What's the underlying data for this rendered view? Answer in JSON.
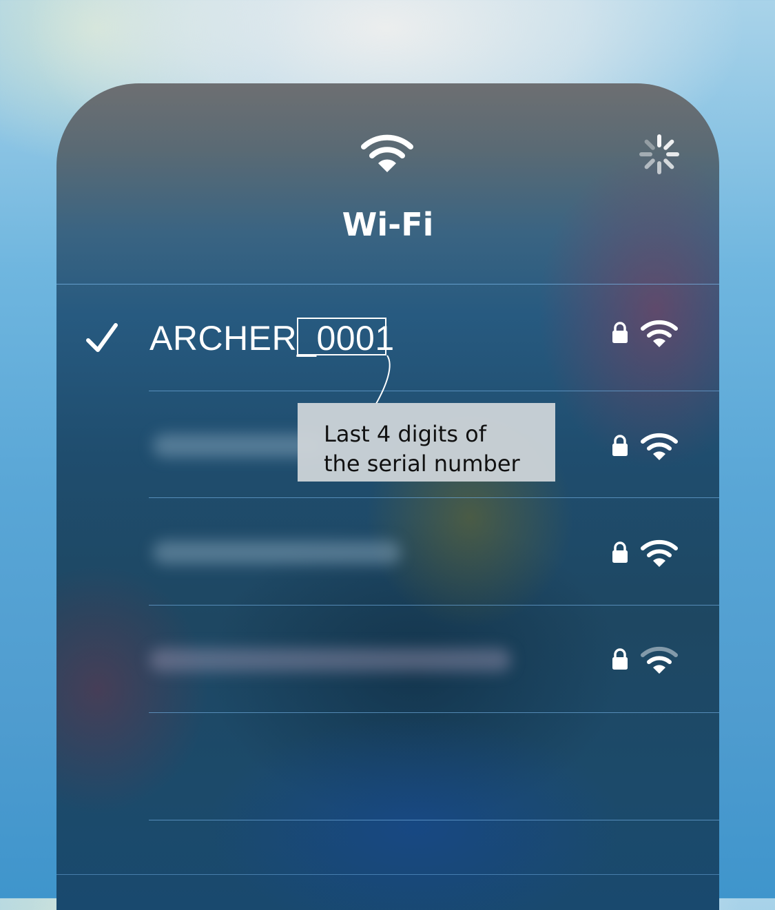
{
  "header": {
    "title": "Wi-Fi",
    "icon": "wifi-icon",
    "spinner_icon": "loading-spinner-icon"
  },
  "networks": [
    {
      "name": "ARCHER_0001",
      "connected": true,
      "secured": true,
      "signal": "full",
      "name_visible": true
    },
    {
      "name": "",
      "connected": false,
      "secured": true,
      "signal": "full",
      "name_visible": false
    },
    {
      "name": "",
      "connected": false,
      "secured": true,
      "signal": "full",
      "name_visible": false
    },
    {
      "name": "",
      "connected": false,
      "secured": true,
      "signal": "medium",
      "name_visible": false
    }
  ],
  "annotation": {
    "highlighted_text": "0001",
    "line1": "Last 4 digits of",
    "line2": "the serial number"
  },
  "colors": {
    "text": "#ffffff",
    "separator": "#6eaadc",
    "callout_bg": "#cdd4d8"
  }
}
